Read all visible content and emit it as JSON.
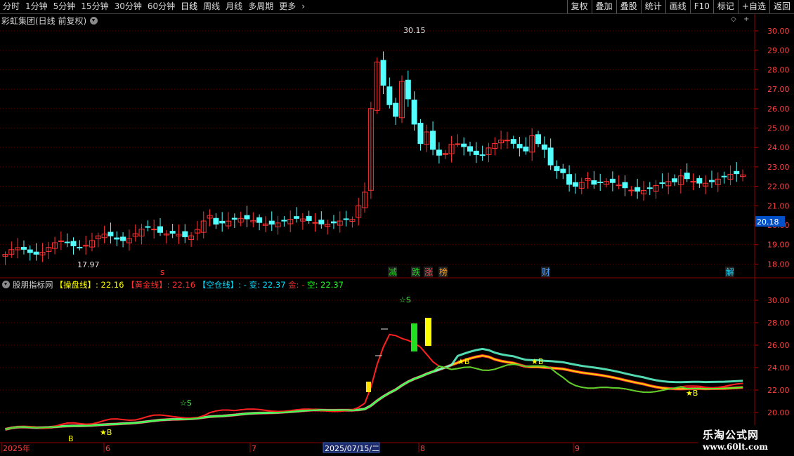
{
  "toolbar": {
    "periods": [
      "分时",
      "1分钟",
      "5分钟",
      "15分钟",
      "30分钟",
      "60分钟",
      "日线",
      "周线",
      "月线",
      "多周期",
      "更多"
    ],
    "active_period": "日线",
    "more_arrow": "›",
    "right_buttons": [
      "复权",
      "叠加",
      "叠股",
      "统计",
      "画线",
      "F10",
      "标记",
      "+自选",
      "返回"
    ]
  },
  "stock_title": "彩虹集团(日线 前复权)",
  "price_axis": {
    "ticks": [
      "30.00",
      "29.00",
      "28.00",
      "27.00",
      "26.00",
      "25.00",
      "24.00",
      "23.00",
      "22.00",
      "21.00",
      "20.00",
      "19.00",
      "18.00"
    ],
    "current_price": "20.18"
  },
  "main_chart": {
    "high_label": "30.15",
    "low_label": "17.97",
    "markers": [
      {
        "text": "s",
        "color": "#ff3030"
      },
      {
        "text": "减",
        "color": "#20d020"
      },
      {
        "text": "跌",
        "color": "#20d020"
      },
      {
        "text": "涨",
        "color": "#ff4040"
      },
      {
        "text": "榜",
        "color": "#ffa020"
      },
      {
        "text": "财",
        "color": "#50a0ff"
      },
      {
        "text": "解",
        "color": "#20d8ff"
      }
    ]
  },
  "indicator": {
    "name": "股朋指标网",
    "items": [
      {
        "label": "【操盘线】",
        "value": ": 22.16",
        "color": "#ffff00"
      },
      {
        "label": "【黄金线】",
        "value": ": 22.16",
        "color": "#ff3030"
      },
      {
        "label": "【空仓线】",
        "value": ": - 变: 22.37",
        "color": "#00e0ff"
      },
      {
        "label": "金:",
        "value": " - ",
        "color": "#ff3030"
      },
      {
        "label": "空:",
        "value": " 22.37",
        "color": "#20ff20"
      }
    ],
    "axis_ticks": [
      "30.00",
      "28.00",
      "26.00",
      "24.00",
      "22.00",
      "20.00"
    ],
    "signals": [
      "☆S",
      "☆S",
      "★B",
      "★B",
      "★B",
      "★B",
      "B"
    ]
  },
  "date_axis": {
    "labels": [
      "2025年",
      "6",
      "7",
      "8",
      "9"
    ],
    "cursor_date": "2025/07/15/二"
  },
  "watermark": {
    "name": "乐淘公式网",
    "url": "www.60lt.com"
  },
  "colors": {
    "up": "#ff3232",
    "down": "#54ffff",
    "grid": "#550000",
    "axis_text": "#ff4040"
  }
}
